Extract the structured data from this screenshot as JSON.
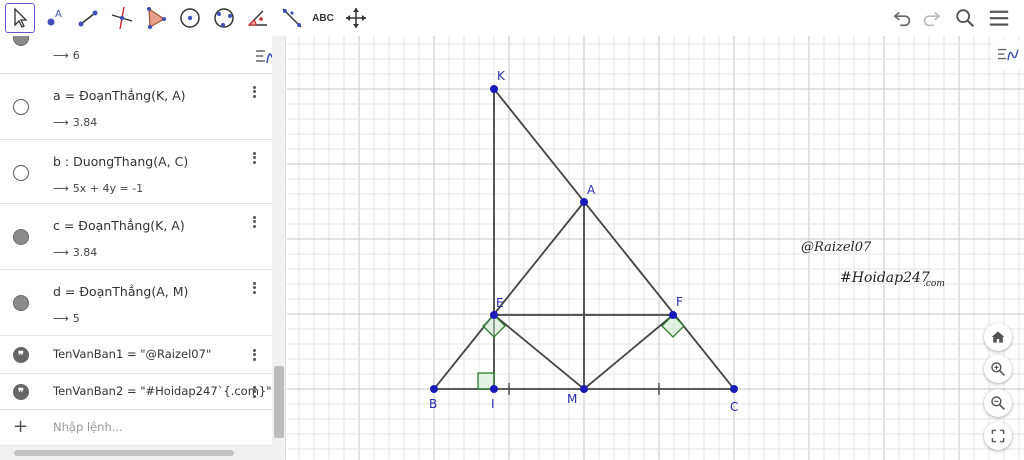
{
  "toolbar": {
    "tools": [
      {
        "name": "move-tool",
        "label": ""
      },
      {
        "name": "point-tool",
        "label": ""
      },
      {
        "name": "segment-tool",
        "label": ""
      },
      {
        "name": "perpendicular-line-tool",
        "label": ""
      },
      {
        "name": "polygon-tool",
        "label": ""
      },
      {
        "name": "circle-center-point-tool",
        "label": ""
      },
      {
        "name": "circle-three-points-tool",
        "label": ""
      },
      {
        "name": "angle-tool",
        "label": ""
      },
      {
        "name": "reflect-tool",
        "label": ""
      },
      {
        "name": "text-tool",
        "label": "ABC"
      },
      {
        "name": "move-graphics-view-tool",
        "label": ""
      }
    ]
  },
  "algebra": {
    "rows": [
      {
        "definition": "",
        "value": "6",
        "marble": "filled"
      },
      {
        "definition": "a = ĐoạnThẳng(K, A)",
        "value": "3.84",
        "marble": "empty"
      },
      {
        "definition": "b : DuongThang(A, C)",
        "value": "5x + 4y = -1",
        "marble": "empty"
      },
      {
        "definition": "c = ĐoạnThẳng(K, A)",
        "value": "3.84",
        "marble": "filled"
      },
      {
        "definition": "d = ĐoạnThẳng(A, M)",
        "value": "5",
        "marble": "filled"
      },
      {
        "definition": "TenVanBan1 = \"@Raizel07\"",
        "value": "",
        "marble": "text"
      },
      {
        "definition": "TenVanBan2 = \"#Hoidap247`{.com}\"",
        "value": "",
        "marble": "text"
      }
    ],
    "input_placeholder": "Nhập lệnh..."
  },
  "graphics": {
    "points": [
      {
        "id": "K",
        "label": "K"
      },
      {
        "id": "A",
        "label": "A"
      },
      {
        "id": "E",
        "label": "E"
      },
      {
        "id": "F",
        "label": "F"
      },
      {
        "id": "B",
        "label": "B"
      },
      {
        "id": "I",
        "label": "I"
      },
      {
        "id": "M",
        "label": "M"
      },
      {
        "id": "C",
        "label": "C"
      }
    ],
    "text_raizel": "@Raizel07",
    "text_hoidap": "#Hoidap247",
    "text_hoidap_sub": ".com"
  },
  "colors": {
    "point": "#1a1ab8",
    "segment": "#444444",
    "right_angle_stroke": "#2e7d32",
    "right_angle_fill": "#c8e6c9",
    "grid_minor": "#e6e6e6",
    "grid_major": "#c4c4c4",
    "label": "#2a2ab0",
    "tool_selected": "#6557d2"
  }
}
